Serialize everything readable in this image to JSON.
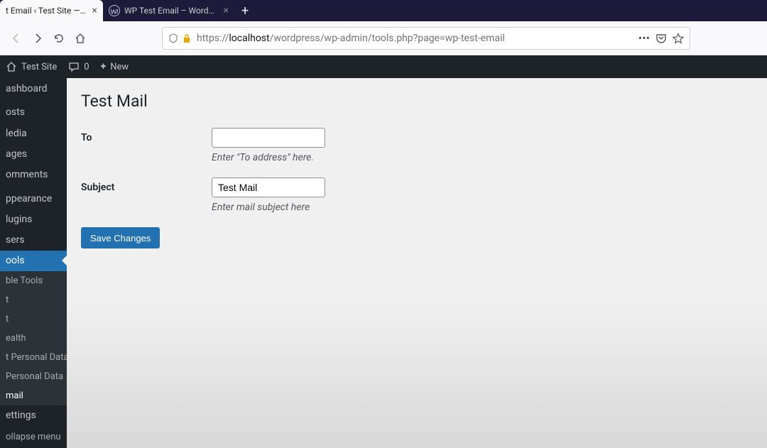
{
  "tabs": {
    "active": {
      "label": "t Email ‹ Test Site — WordP"
    },
    "second": {
      "label": "WP Test Email – WordPress plu"
    }
  },
  "url": {
    "prefix": "https://",
    "host": "localhost",
    "path": "/wordpress/wp-admin/tools.php?page=wp-test-email"
  },
  "adminbar": {
    "site": "Test Site",
    "comments": "0",
    "new": "New"
  },
  "menu": {
    "dashboard": "ashboard",
    "posts": "osts",
    "media": "ledia",
    "pages": "ages",
    "comments": "omments",
    "appearance": "ppearance",
    "plugins": "lugins",
    "users": "sers",
    "tools": "ools",
    "settings": "ettings",
    "collapse": "ollapse menu"
  },
  "submenu": {
    "available": "ble Tools",
    "import": "t",
    "export": "t",
    "health": "ealth",
    "export_pd": "t Personal Data",
    "erase_pd": "Personal Data",
    "mail": "mail"
  },
  "page": {
    "title": "Test Mail",
    "to_label": "To",
    "to_value": "",
    "to_help": "Enter \"To address\" here.",
    "subject_label": "Subject",
    "subject_value": "Test Mail",
    "subject_help": "Enter mail subject here",
    "save": "Save Changes"
  }
}
